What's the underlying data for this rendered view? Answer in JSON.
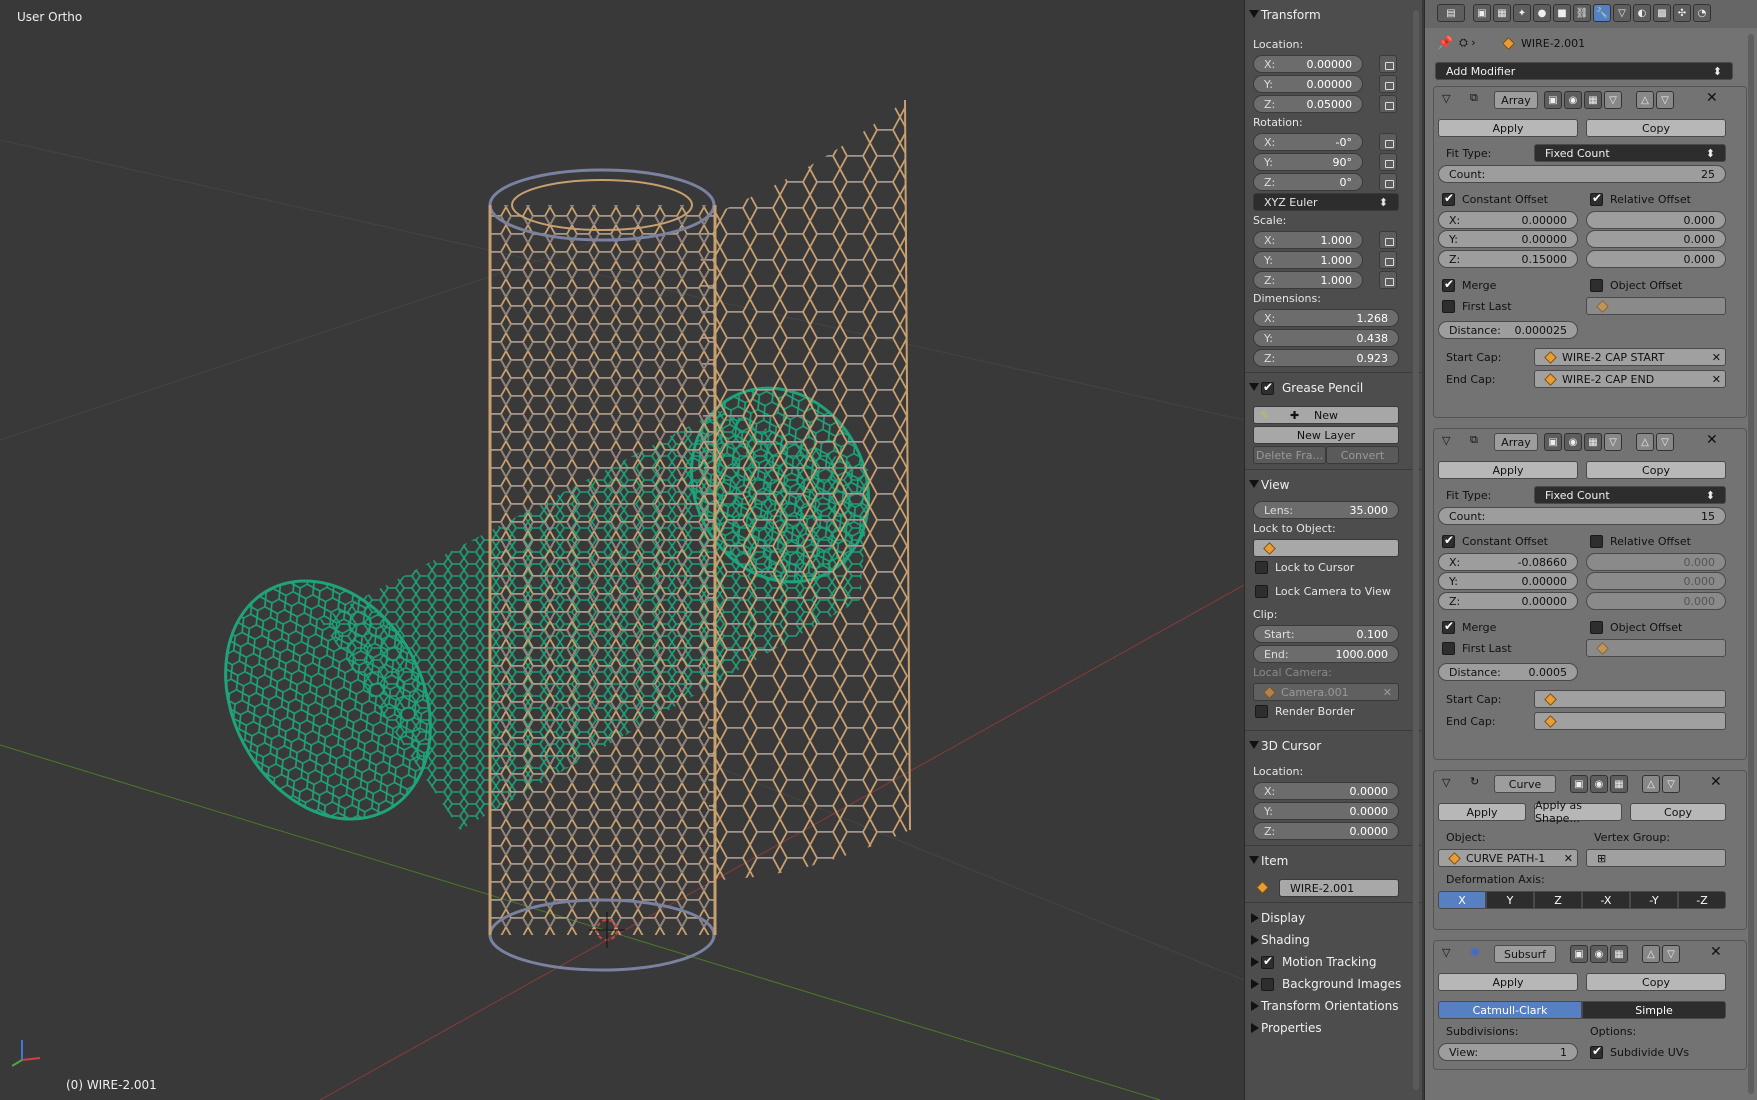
{
  "viewport": {
    "view_label": "User Ortho",
    "object_label": "(0) WIRE-2.001"
  },
  "transform": {
    "title": "Transform",
    "location_label": "Location:",
    "loc": [
      {
        "k": "X:",
        "v": "0.00000"
      },
      {
        "k": "Y:",
        "v": "0.00000"
      },
      {
        "k": "Z:",
        "v": "0.05000"
      }
    ],
    "rotation_label": "Rotation:",
    "rot": [
      {
        "k": "X:",
        "v": "-0°"
      },
      {
        "k": "Y:",
        "v": "90°"
      },
      {
        "k": "Z:",
        "v": "0°"
      }
    ],
    "rotation_mode": "XYZ Euler",
    "scale_label": "Scale:",
    "scale": [
      {
        "k": "X:",
        "v": "1.000"
      },
      {
        "k": "Y:",
        "v": "1.000"
      },
      {
        "k": "Z:",
        "v": "1.000"
      }
    ],
    "dimensions_label": "Dimensions:",
    "dim": [
      {
        "k": "X:",
        "v": "1.268"
      },
      {
        "k": "Y:",
        "v": "0.438"
      },
      {
        "k": "Z:",
        "v": "0.923"
      }
    ]
  },
  "grease": {
    "title": "Grease Pencil",
    "new": "New",
    "new_layer": "New Layer",
    "delete_frame": "Delete Fra...",
    "convert": "Convert"
  },
  "view": {
    "title": "View",
    "lens_k": "Lens:",
    "lens_v": "35.000",
    "lock_obj": "Lock to Object:",
    "lock_cursor": "Lock to Cursor",
    "lock_camera": "Lock Camera to View",
    "clip": "Clip:",
    "start_k": "Start:",
    "start_v": "0.100",
    "end_k": "End:",
    "end_v": "1000.000",
    "local_camera": "Local Camera:",
    "camera": "Camera.001",
    "render_border": "Render Border"
  },
  "cursor": {
    "title": "3D Cursor",
    "location_label": "Location:",
    "loc": [
      {
        "k": "X:",
        "v": "0.0000"
      },
      {
        "k": "Y:",
        "v": "0.0000"
      },
      {
        "k": "Z:",
        "v": "0.0000"
      }
    ]
  },
  "item": {
    "title": "Item",
    "name": "WIRE-2.001"
  },
  "collapsed": {
    "display": "Display",
    "shading": "Shading",
    "motion": "Motion Tracking",
    "background": "Background Images",
    "orient": "Transform Orientations",
    "properties": "Properties"
  },
  "props": {
    "object_name": "WIRE-2.001",
    "add_modifier": "Add Modifier",
    "apply": "Apply",
    "copy": "Copy",
    "apply_shape": "Apply as Shape...",
    "fit_type_label": "Fit Type:",
    "fit_type": "Fixed Count",
    "count_k": "Count:",
    "constant_offset": "Constant Offset",
    "relative_offset": "Relative Offset",
    "merge": "Merge",
    "object_offset": "Object Offset",
    "first_last": "First Last",
    "distance_k": "Distance:",
    "start_cap": "Start Cap:",
    "end_cap": "End Cap:",
    "array1": {
      "name": "Array",
      "count": "25",
      "c": [
        {
          "k": "X:",
          "v": "0.00000"
        },
        {
          "k": "Y:",
          "v": "0.00000"
        },
        {
          "k": "Z:",
          "v": "0.15000"
        }
      ],
      "r": [
        "0.000",
        "0.000",
        "0.000"
      ],
      "distance": "0.000025",
      "start_cap": "WIRE-2 CAP START",
      "end_cap": "WIRE-2 CAP END"
    },
    "array2": {
      "name": "Array",
      "count": "15",
      "c": [
        {
          "k": "X:",
          "v": "-0.08660"
        },
        {
          "k": "Y:",
          "v": "0.00000"
        },
        {
          "k": "Z:",
          "v": "0.00000"
        }
      ],
      "r": [
        "0.000",
        "0.000",
        "0.000"
      ],
      "distance": "0.0005"
    },
    "curve": {
      "name": "Curve",
      "object_label": "Object:",
      "vertex_group_label": "Vertex Group:",
      "object": "CURVE PATH-1",
      "deform_label": "Deformation Axis:",
      "axes": [
        "X",
        "Y",
        "Z",
        "-X",
        "-Y",
        "-Z"
      ]
    },
    "subsurf": {
      "name": "Subsurf",
      "catmull": "Catmull-Clark",
      "simple": "Simple",
      "subdivisions": "Subdivisions:",
      "options": "Options:",
      "view_k": "View:",
      "view_v": "1",
      "subdivide_uvs": "Subdivide UVs"
    }
  }
}
